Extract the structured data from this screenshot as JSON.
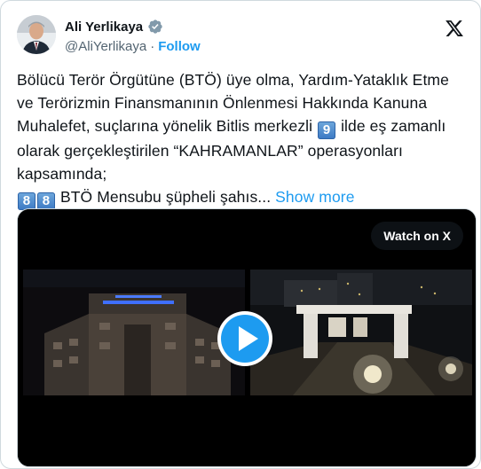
{
  "author": {
    "name": "Ali Yerlikaya",
    "handle": "@AliYerlikaya",
    "separator": "·",
    "follow_label": "Follow"
  },
  "tweet": {
    "text_part1": "Bölücü Terör Örgütüne (BTÖ) üye olma, Yardım-Yataklık Etme ve Terörizmin Finansmanının Önlenmesi Hakkında Kanuna Muhalefet, suçlarına yönelik Bitlis merkezli ",
    "keycap_9": "9",
    "text_part2": " ilde eş zamanlı olarak gerçekleştirilen “KAHRAMANLAR” operasyonları kapsamında;",
    "keycap_8a": "8",
    "keycap_8b": "8",
    "text_part3": " BTÖ Mensubu şüpheli şahıs... ",
    "show_more": "Show more"
  },
  "media": {
    "watch_label": "Watch on X"
  },
  "colors": {
    "accent": "#1d9bf0",
    "verified": "#829aab"
  },
  "icons": [
    "verified-badge-icon",
    "x-logo-icon",
    "play-icon"
  ]
}
